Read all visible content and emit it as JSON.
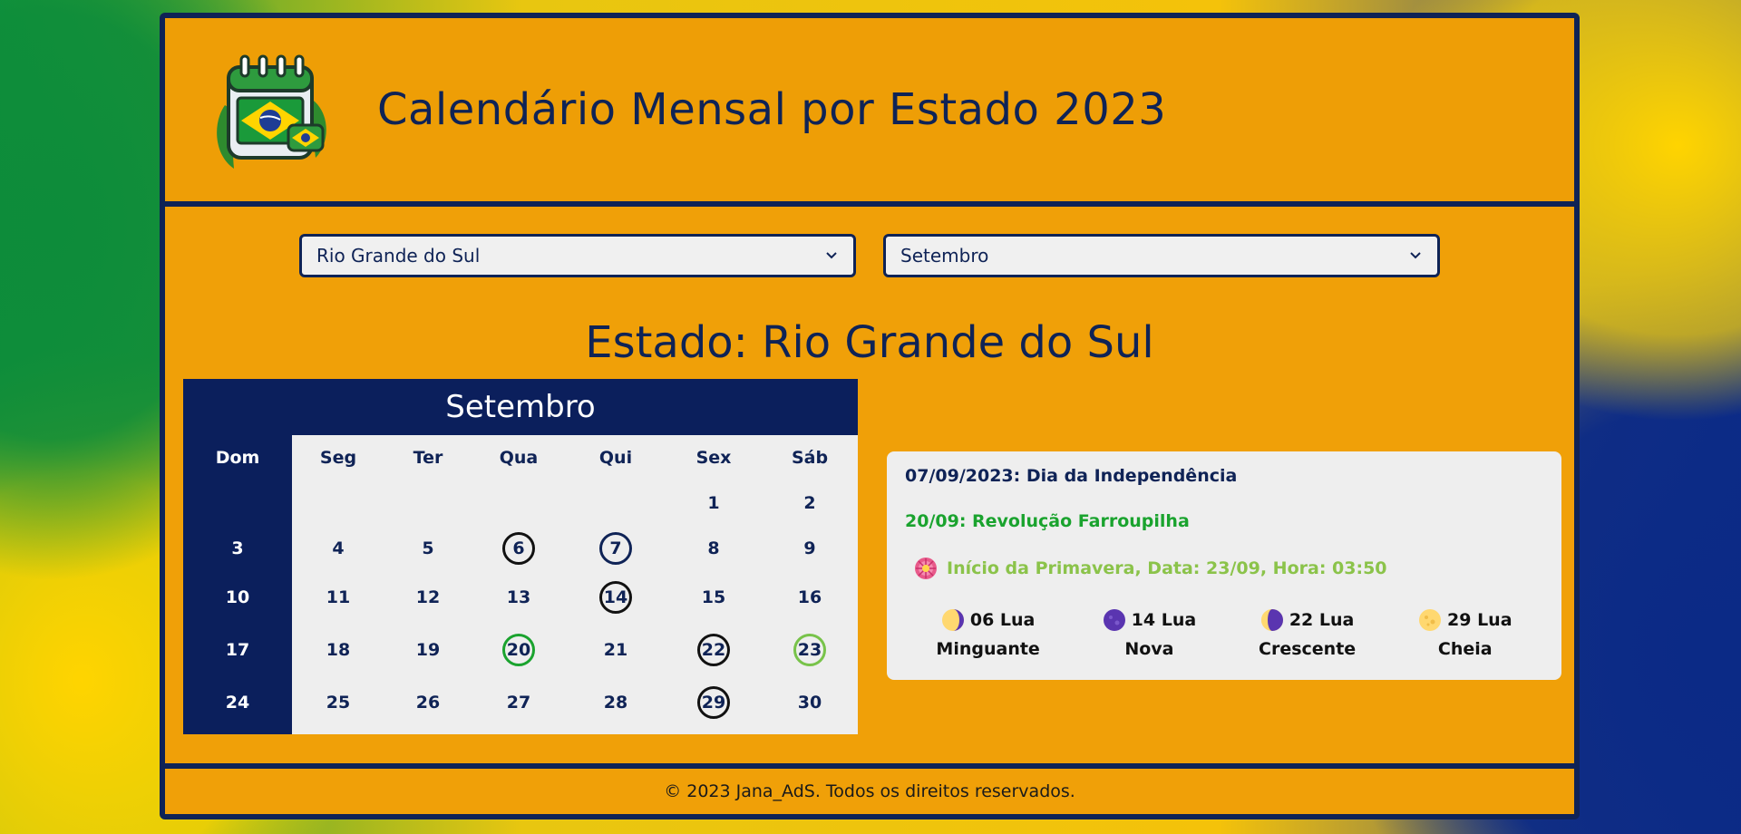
{
  "header": {
    "title": "Calendário Mensal por Estado 2023",
    "logo_icon": "brazil-calendar-icon"
  },
  "controls": {
    "state_select": "Rio Grande do Sul",
    "month_select": "Setembro"
  },
  "state_heading": "Estado: Rio Grande do Sul",
  "calendar": {
    "month": "Setembro",
    "weekdays": [
      "Dom",
      "Seg",
      "Ter",
      "Qua",
      "Qui",
      "Sex",
      "Sáb"
    ],
    "weeks": [
      [
        "",
        "",
        "",
        "",
        "",
        "1",
        "2"
      ],
      [
        "3",
        "4",
        "5",
        "6",
        "7",
        "8",
        "9"
      ],
      [
        "10",
        "11",
        "12",
        "13",
        "14",
        "15",
        "16"
      ],
      [
        "17",
        "18",
        "19",
        "20",
        "21",
        "22",
        "23"
      ],
      [
        "24",
        "25",
        "26",
        "27",
        "28",
        "29",
        "30"
      ]
    ],
    "highlight_colors": {
      "black": "#111111",
      "blue": "#0f2356",
      "green": "#1aa32e",
      "light_green": "#78c34a"
    }
  },
  "events": {
    "holiday": "07/09/2023: Dia da Independência",
    "regional": "20/09: Revolução Farroupilha",
    "season": "Início da Primavera, Data: 23/09, Hora: 03:50",
    "season_icon": "flower-icon"
  },
  "moons": [
    {
      "day_label": "06 Lua",
      "phase": "Minguante",
      "icon": "waning-moon-icon"
    },
    {
      "day_label": "14 Lua",
      "phase": "Nova",
      "icon": "new-moon-icon"
    },
    {
      "day_label": "22 Lua",
      "phase": "Crescente",
      "icon": "waxing-moon-icon"
    },
    {
      "day_label": "29 Lua",
      "phase": "Cheia",
      "icon": "full-moon-icon"
    }
  ],
  "footer": {
    "text": "© 2023 Jana_AdS. Todos os direitos reservados."
  },
  "colors": {
    "accent": "#f0a008",
    "navy": "#0f2356",
    "panel": "#eeeeee"
  }
}
